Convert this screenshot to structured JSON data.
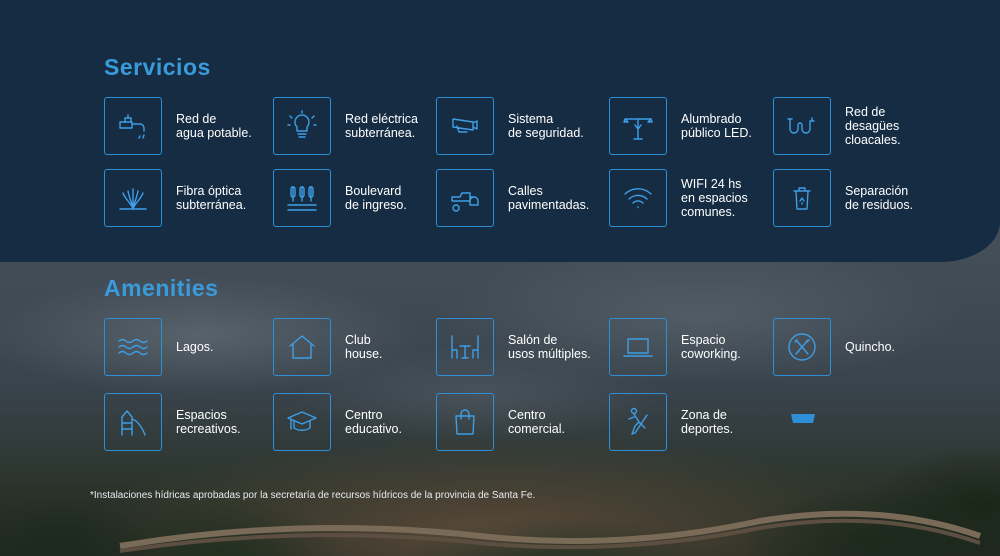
{
  "servicios": {
    "title": "Servicios",
    "items": [
      {
        "label": "Red de\nagua potable.",
        "icon": "faucet-icon"
      },
      {
        "label": "Red eléctrica\nsubterránea.",
        "icon": "lightbulb-icon"
      },
      {
        "label": "Sistema\nde seguridad.",
        "icon": "security-camera-icon"
      },
      {
        "label": "Alumbrado\npúblico LED.",
        "icon": "street-light-icon"
      },
      {
        "label": "Red de\ndesagües\ncloacales.",
        "icon": "drain-pipe-icon"
      },
      {
        "label": "Fibra óptica\nsubterránea.",
        "icon": "fiber-optic-icon"
      },
      {
        "label": "Boulevard\nde ingreso.",
        "icon": "boulevard-icon"
      },
      {
        "label": "Calles\npavimentadas.",
        "icon": "road-roller-icon"
      },
      {
        "label": "WIFI 24 hs\nen espacios\ncomunes.",
        "icon": "wifi-icon"
      },
      {
        "label": "Separación\nde residuos.",
        "icon": "recycle-bin-icon"
      }
    ]
  },
  "amenities": {
    "title": "Amenities",
    "items": [
      {
        "label": "Lagos.",
        "icon": "waves-icon"
      },
      {
        "label": "Club\nhouse.",
        "icon": "house-icon"
      },
      {
        "label": "Salón de\nusos múltiples.",
        "icon": "tables-chairs-icon"
      },
      {
        "label": "Espacio\ncoworking.",
        "icon": "laptop-icon"
      },
      {
        "label": "Quincho.",
        "icon": "grill-utensils-icon"
      },
      {
        "label": "Espacios\nrecreativos.",
        "icon": "playground-icon"
      },
      {
        "label": "Centro\neducativo.",
        "icon": "graduation-cap-icon"
      },
      {
        "label": "Centro\ncomercial.",
        "icon": "shopping-bag-icon"
      },
      {
        "label": "Zona de\ndeportes.",
        "icon": "hockey-player-icon"
      }
    ]
  },
  "footnote": "*Instalaciones hídricas aprobadas por la secretaría de recursos hídricos de la provincia de Santa Fe.",
  "colors": {
    "panel": "#152c43",
    "accent": "#3a9bdc",
    "text": "#ffffff"
  }
}
